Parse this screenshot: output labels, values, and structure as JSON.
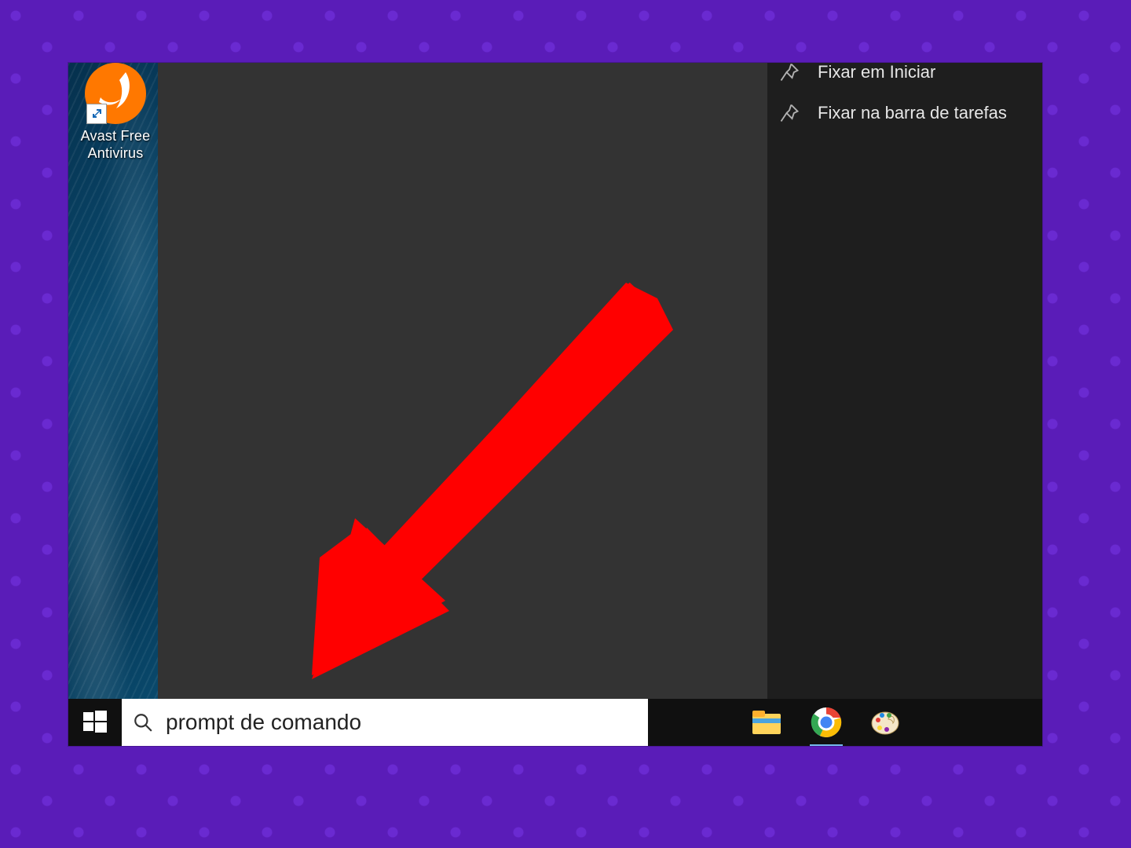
{
  "desktop_icons": [
    {
      "name": "avast",
      "label": "Avast Free\nAntivirus"
    }
  ],
  "actions": [
    {
      "label": "Fixar em Iniciar"
    },
    {
      "label": "Fixar na barra de tarefas"
    }
  ],
  "search": {
    "value": "prompt de comando",
    "placeholder": ""
  },
  "taskbar_apps": [
    {
      "name": "file-explorer",
      "active": false
    },
    {
      "name": "chrome",
      "active": true
    },
    {
      "name": "paint",
      "active": false
    }
  ],
  "colors": {
    "page_bg": "#5a1cb8",
    "panel_dark": "#333333",
    "panel_darker": "#1e1e1e",
    "taskbar": "#101010",
    "annotation": "#ff0000",
    "avast": "#ff7800"
  }
}
